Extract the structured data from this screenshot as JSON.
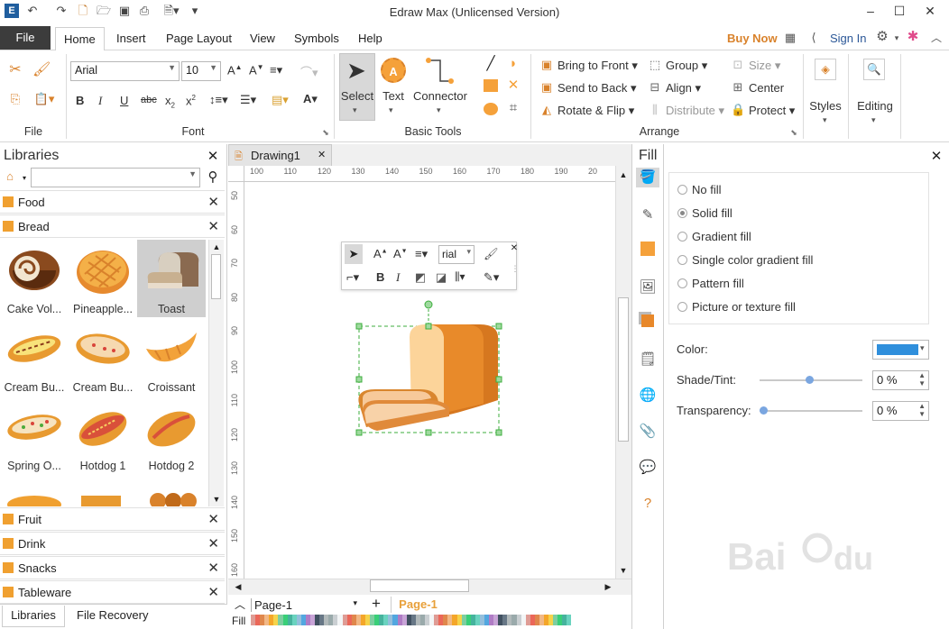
{
  "app": {
    "title": "Edraw Max (Unlicensed Version)"
  },
  "menu": {
    "file": "File",
    "tabs": [
      "Home",
      "Insert",
      "Page Layout",
      "View",
      "Symbols",
      "Help"
    ],
    "buy_now": "Buy Now",
    "sign_in": "Sign In"
  },
  "ribbon": {
    "groups": {
      "file": "File",
      "font": "Font",
      "basic_tools": "Basic Tools",
      "arrange": "Arrange"
    },
    "font_name": "Arial",
    "font_size": "10",
    "tools": {
      "select": "Select",
      "text": "Text",
      "connector": "Connector"
    },
    "arrange": {
      "bring_front": "Bring to Front",
      "send_back": "Send to Back",
      "rotate_flip": "Rotate & Flip",
      "group": "Group",
      "align": "Align",
      "distribute": "Distribute",
      "size": "Size",
      "center": "Center",
      "protect": "Protect"
    },
    "styles": "Styles",
    "editing": "Editing"
  },
  "libraries": {
    "title": "Libraries",
    "categories": [
      "Food",
      "Bread"
    ],
    "shapes": [
      {
        "label": "Cake Vol...",
        "selected": false
      },
      {
        "label": "Pineapple...",
        "selected": false
      },
      {
        "label": "Toast",
        "selected": true
      },
      {
        "label": "Cream Bu...",
        "selected": false
      },
      {
        "label": "Cream Bu...",
        "selected": false
      },
      {
        "label": "Croissant",
        "selected": false
      },
      {
        "label": "Spring O...",
        "selected": false
      },
      {
        "label": "Hotdog 1",
        "selected": false
      },
      {
        "label": "Hotdog 2",
        "selected": false
      }
    ],
    "bottom_categories": [
      "Fruit",
      "Drink",
      "Snacks",
      "Tableware"
    ],
    "bottom_tabs": [
      "Libraries",
      "File Recovery"
    ]
  },
  "canvas": {
    "doc_tab": "Drawing1",
    "ruler_h": [
      "100",
      "110",
      "120",
      "130",
      "140",
      "150",
      "160",
      "170",
      "180",
      "190",
      "20"
    ],
    "ruler_v": [
      "50",
      "60",
      "70",
      "80",
      "90",
      "100",
      "110",
      "120",
      "130",
      "140",
      "150",
      "160"
    ],
    "mini_font": "rial",
    "page_selector": "Page-1",
    "page_tab": "Page-1",
    "fill_label": "Fill"
  },
  "fill_panel": {
    "title": "Fill",
    "options": [
      {
        "label": "No fill",
        "selected": false
      },
      {
        "label": "Solid fill",
        "selected": true
      },
      {
        "label": "Gradient fill",
        "selected": false
      },
      {
        "label": "Single color gradient fill",
        "selected": false
      },
      {
        "label": "Pattern fill",
        "selected": false
      },
      {
        "label": "Picture or texture fill",
        "selected": false
      }
    ],
    "color_label": "Color:",
    "color_value": "#2f8fdc",
    "shade_label": "Shade/Tint:",
    "shade_value": "0 %",
    "shade_level": 0.5,
    "transparency_label": "Transparency:",
    "transparency_value": "0 %",
    "transparency_level": 0
  },
  "colors": {
    "accent": "#d9822b",
    "signin": "#2b5797",
    "file_tab": "#3c3c3c"
  }
}
